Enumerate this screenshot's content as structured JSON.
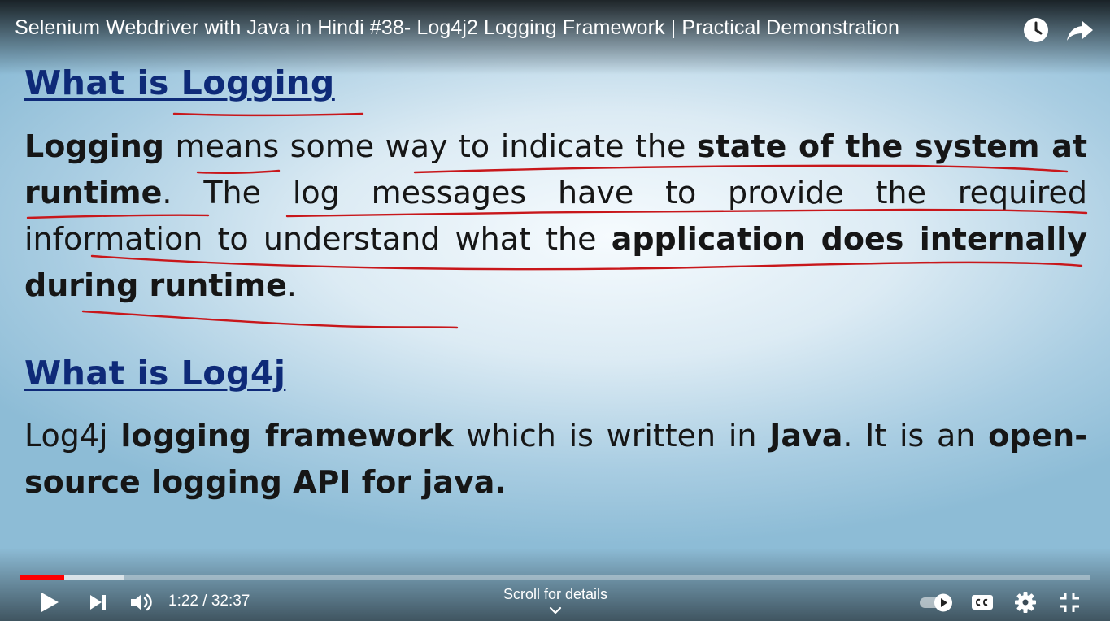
{
  "video": {
    "title": "Selenium Webdriver with Java in Hindi #38- Log4j2 Logging Framework | Practical Demonstration"
  },
  "slide": {
    "heading1": "What is Logging",
    "p1": {
      "s1": "Logging",
      "s2": " means some way to indicate the ",
      "s3": "state of the system at runtime",
      "s4": ". The log messages have to provide the required information to understand what the ",
      "s5": "application does internally during runtime",
      "s6": "."
    },
    "heading2": "What is Log4j",
    "p2": {
      "s1": "Log4j  ",
      "s2": "logging framework",
      "s3": " which is written in ",
      "s4": "Java",
      "s5": ". It is an ",
      "s6": "open-source logging API for java."
    }
  },
  "controls": {
    "current_time": "1:22",
    "separator": " / ",
    "duration": "32:37",
    "scroll_hint": "Scroll for details",
    "progress": {
      "played_fraction": 0.042,
      "loaded_fraction": 0.098
    }
  },
  "icons": {
    "watch_later": "clock-icon",
    "share": "share-arrow-icon",
    "play": "play-icon",
    "next": "skip-next-icon",
    "volume": "volume-icon",
    "autoplay": "autoplay-toggle-icon",
    "captions": "captions-icon",
    "settings": "gear-icon",
    "exit_fullscreen": "exit-fullscreen-icon",
    "scroll": "chevron-down-icon"
  },
  "colors": {
    "heading": "#0e2a78",
    "annotation": "#c8171b",
    "progress_played": "#ff0000"
  }
}
